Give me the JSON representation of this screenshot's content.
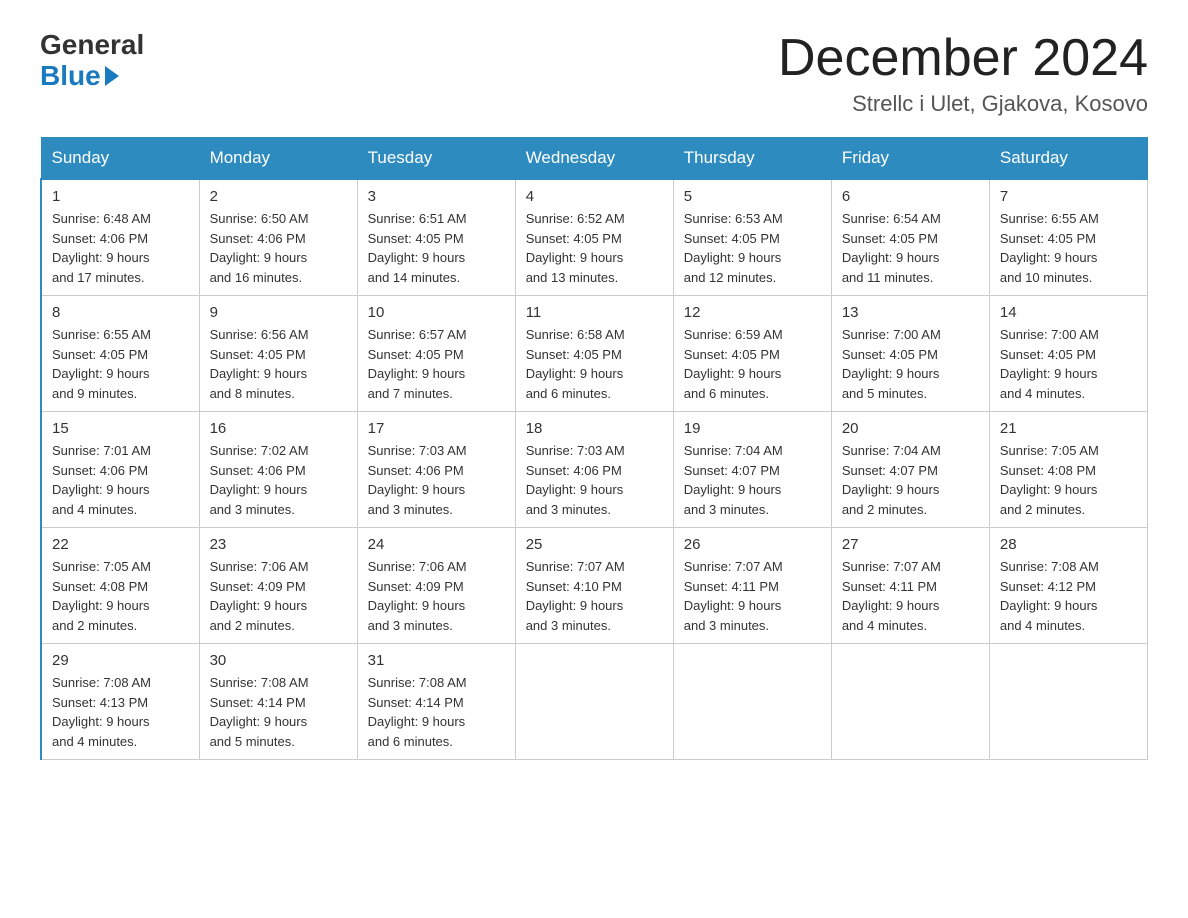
{
  "logo": {
    "general": "General",
    "blue": "Blue"
  },
  "title": "December 2024",
  "subtitle": "Strellc i Ulet, Gjakova, Kosovo",
  "days_of_week": [
    "Sunday",
    "Monday",
    "Tuesday",
    "Wednesday",
    "Thursday",
    "Friday",
    "Saturday"
  ],
  "weeks": [
    [
      {
        "day": "1",
        "info": "Sunrise: 6:48 AM\nSunset: 4:06 PM\nDaylight: 9 hours\nand 17 minutes."
      },
      {
        "day": "2",
        "info": "Sunrise: 6:50 AM\nSunset: 4:06 PM\nDaylight: 9 hours\nand 16 minutes."
      },
      {
        "day": "3",
        "info": "Sunrise: 6:51 AM\nSunset: 4:05 PM\nDaylight: 9 hours\nand 14 minutes."
      },
      {
        "day": "4",
        "info": "Sunrise: 6:52 AM\nSunset: 4:05 PM\nDaylight: 9 hours\nand 13 minutes."
      },
      {
        "day": "5",
        "info": "Sunrise: 6:53 AM\nSunset: 4:05 PM\nDaylight: 9 hours\nand 12 minutes."
      },
      {
        "day": "6",
        "info": "Sunrise: 6:54 AM\nSunset: 4:05 PM\nDaylight: 9 hours\nand 11 minutes."
      },
      {
        "day": "7",
        "info": "Sunrise: 6:55 AM\nSunset: 4:05 PM\nDaylight: 9 hours\nand 10 minutes."
      }
    ],
    [
      {
        "day": "8",
        "info": "Sunrise: 6:55 AM\nSunset: 4:05 PM\nDaylight: 9 hours\nand 9 minutes."
      },
      {
        "day": "9",
        "info": "Sunrise: 6:56 AM\nSunset: 4:05 PM\nDaylight: 9 hours\nand 8 minutes."
      },
      {
        "day": "10",
        "info": "Sunrise: 6:57 AM\nSunset: 4:05 PM\nDaylight: 9 hours\nand 7 minutes."
      },
      {
        "day": "11",
        "info": "Sunrise: 6:58 AM\nSunset: 4:05 PM\nDaylight: 9 hours\nand 6 minutes."
      },
      {
        "day": "12",
        "info": "Sunrise: 6:59 AM\nSunset: 4:05 PM\nDaylight: 9 hours\nand 6 minutes."
      },
      {
        "day": "13",
        "info": "Sunrise: 7:00 AM\nSunset: 4:05 PM\nDaylight: 9 hours\nand 5 minutes."
      },
      {
        "day": "14",
        "info": "Sunrise: 7:00 AM\nSunset: 4:05 PM\nDaylight: 9 hours\nand 4 minutes."
      }
    ],
    [
      {
        "day": "15",
        "info": "Sunrise: 7:01 AM\nSunset: 4:06 PM\nDaylight: 9 hours\nand 4 minutes."
      },
      {
        "day": "16",
        "info": "Sunrise: 7:02 AM\nSunset: 4:06 PM\nDaylight: 9 hours\nand 3 minutes."
      },
      {
        "day": "17",
        "info": "Sunrise: 7:03 AM\nSunset: 4:06 PM\nDaylight: 9 hours\nand 3 minutes."
      },
      {
        "day": "18",
        "info": "Sunrise: 7:03 AM\nSunset: 4:06 PM\nDaylight: 9 hours\nand 3 minutes."
      },
      {
        "day": "19",
        "info": "Sunrise: 7:04 AM\nSunset: 4:07 PM\nDaylight: 9 hours\nand 3 minutes."
      },
      {
        "day": "20",
        "info": "Sunrise: 7:04 AM\nSunset: 4:07 PM\nDaylight: 9 hours\nand 2 minutes."
      },
      {
        "day": "21",
        "info": "Sunrise: 7:05 AM\nSunset: 4:08 PM\nDaylight: 9 hours\nand 2 minutes."
      }
    ],
    [
      {
        "day": "22",
        "info": "Sunrise: 7:05 AM\nSunset: 4:08 PM\nDaylight: 9 hours\nand 2 minutes."
      },
      {
        "day": "23",
        "info": "Sunrise: 7:06 AM\nSunset: 4:09 PM\nDaylight: 9 hours\nand 2 minutes."
      },
      {
        "day": "24",
        "info": "Sunrise: 7:06 AM\nSunset: 4:09 PM\nDaylight: 9 hours\nand 3 minutes."
      },
      {
        "day": "25",
        "info": "Sunrise: 7:07 AM\nSunset: 4:10 PM\nDaylight: 9 hours\nand 3 minutes."
      },
      {
        "day": "26",
        "info": "Sunrise: 7:07 AM\nSunset: 4:11 PM\nDaylight: 9 hours\nand 3 minutes."
      },
      {
        "day": "27",
        "info": "Sunrise: 7:07 AM\nSunset: 4:11 PM\nDaylight: 9 hours\nand 4 minutes."
      },
      {
        "day": "28",
        "info": "Sunrise: 7:08 AM\nSunset: 4:12 PM\nDaylight: 9 hours\nand 4 minutes."
      }
    ],
    [
      {
        "day": "29",
        "info": "Sunrise: 7:08 AM\nSunset: 4:13 PM\nDaylight: 9 hours\nand 4 minutes."
      },
      {
        "day": "30",
        "info": "Sunrise: 7:08 AM\nSunset: 4:14 PM\nDaylight: 9 hours\nand 5 minutes."
      },
      {
        "day": "31",
        "info": "Sunrise: 7:08 AM\nSunset: 4:14 PM\nDaylight: 9 hours\nand 6 minutes."
      },
      {
        "day": "",
        "info": ""
      },
      {
        "day": "",
        "info": ""
      },
      {
        "day": "",
        "info": ""
      },
      {
        "day": "",
        "info": ""
      }
    ]
  ]
}
